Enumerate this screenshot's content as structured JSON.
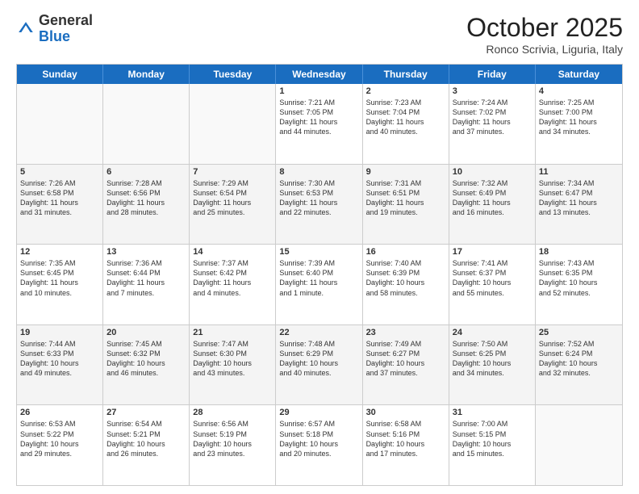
{
  "header": {
    "logo_general": "General",
    "logo_blue": "Blue",
    "month_title": "October 2025",
    "location": "Ronco Scrivia, Liguria, Italy"
  },
  "days_of_week": [
    "Sunday",
    "Monday",
    "Tuesday",
    "Wednesday",
    "Thursday",
    "Friday",
    "Saturday"
  ],
  "rows": [
    {
      "alt": false,
      "cells": [
        {
          "empty": true,
          "day": "",
          "text": ""
        },
        {
          "empty": true,
          "day": "",
          "text": ""
        },
        {
          "empty": true,
          "day": "",
          "text": ""
        },
        {
          "empty": false,
          "day": "1",
          "text": "Sunrise: 7:21 AM\nSunset: 7:05 PM\nDaylight: 11 hours\nand 44 minutes."
        },
        {
          "empty": false,
          "day": "2",
          "text": "Sunrise: 7:23 AM\nSunset: 7:04 PM\nDaylight: 11 hours\nand 40 minutes."
        },
        {
          "empty": false,
          "day": "3",
          "text": "Sunrise: 7:24 AM\nSunset: 7:02 PM\nDaylight: 11 hours\nand 37 minutes."
        },
        {
          "empty": false,
          "day": "4",
          "text": "Sunrise: 7:25 AM\nSunset: 7:00 PM\nDaylight: 11 hours\nand 34 minutes."
        }
      ]
    },
    {
      "alt": true,
      "cells": [
        {
          "empty": false,
          "day": "5",
          "text": "Sunrise: 7:26 AM\nSunset: 6:58 PM\nDaylight: 11 hours\nand 31 minutes."
        },
        {
          "empty": false,
          "day": "6",
          "text": "Sunrise: 7:28 AM\nSunset: 6:56 PM\nDaylight: 11 hours\nand 28 minutes."
        },
        {
          "empty": false,
          "day": "7",
          "text": "Sunrise: 7:29 AM\nSunset: 6:54 PM\nDaylight: 11 hours\nand 25 minutes."
        },
        {
          "empty": false,
          "day": "8",
          "text": "Sunrise: 7:30 AM\nSunset: 6:53 PM\nDaylight: 11 hours\nand 22 minutes."
        },
        {
          "empty": false,
          "day": "9",
          "text": "Sunrise: 7:31 AM\nSunset: 6:51 PM\nDaylight: 11 hours\nand 19 minutes."
        },
        {
          "empty": false,
          "day": "10",
          "text": "Sunrise: 7:32 AM\nSunset: 6:49 PM\nDaylight: 11 hours\nand 16 minutes."
        },
        {
          "empty": false,
          "day": "11",
          "text": "Sunrise: 7:34 AM\nSunset: 6:47 PM\nDaylight: 11 hours\nand 13 minutes."
        }
      ]
    },
    {
      "alt": false,
      "cells": [
        {
          "empty": false,
          "day": "12",
          "text": "Sunrise: 7:35 AM\nSunset: 6:45 PM\nDaylight: 11 hours\nand 10 minutes."
        },
        {
          "empty": false,
          "day": "13",
          "text": "Sunrise: 7:36 AM\nSunset: 6:44 PM\nDaylight: 11 hours\nand 7 minutes."
        },
        {
          "empty": false,
          "day": "14",
          "text": "Sunrise: 7:37 AM\nSunset: 6:42 PM\nDaylight: 11 hours\nand 4 minutes."
        },
        {
          "empty": false,
          "day": "15",
          "text": "Sunrise: 7:39 AM\nSunset: 6:40 PM\nDaylight: 11 hours\nand 1 minute."
        },
        {
          "empty": false,
          "day": "16",
          "text": "Sunrise: 7:40 AM\nSunset: 6:39 PM\nDaylight: 10 hours\nand 58 minutes."
        },
        {
          "empty": false,
          "day": "17",
          "text": "Sunrise: 7:41 AM\nSunset: 6:37 PM\nDaylight: 10 hours\nand 55 minutes."
        },
        {
          "empty": false,
          "day": "18",
          "text": "Sunrise: 7:43 AM\nSunset: 6:35 PM\nDaylight: 10 hours\nand 52 minutes."
        }
      ]
    },
    {
      "alt": true,
      "cells": [
        {
          "empty": false,
          "day": "19",
          "text": "Sunrise: 7:44 AM\nSunset: 6:33 PM\nDaylight: 10 hours\nand 49 minutes."
        },
        {
          "empty": false,
          "day": "20",
          "text": "Sunrise: 7:45 AM\nSunset: 6:32 PM\nDaylight: 10 hours\nand 46 minutes."
        },
        {
          "empty": false,
          "day": "21",
          "text": "Sunrise: 7:47 AM\nSunset: 6:30 PM\nDaylight: 10 hours\nand 43 minutes."
        },
        {
          "empty": false,
          "day": "22",
          "text": "Sunrise: 7:48 AM\nSunset: 6:29 PM\nDaylight: 10 hours\nand 40 minutes."
        },
        {
          "empty": false,
          "day": "23",
          "text": "Sunrise: 7:49 AM\nSunset: 6:27 PM\nDaylight: 10 hours\nand 37 minutes."
        },
        {
          "empty": false,
          "day": "24",
          "text": "Sunrise: 7:50 AM\nSunset: 6:25 PM\nDaylight: 10 hours\nand 34 minutes."
        },
        {
          "empty": false,
          "day": "25",
          "text": "Sunrise: 7:52 AM\nSunset: 6:24 PM\nDaylight: 10 hours\nand 32 minutes."
        }
      ]
    },
    {
      "alt": false,
      "cells": [
        {
          "empty": false,
          "day": "26",
          "text": "Sunrise: 6:53 AM\nSunset: 5:22 PM\nDaylight: 10 hours\nand 29 minutes."
        },
        {
          "empty": false,
          "day": "27",
          "text": "Sunrise: 6:54 AM\nSunset: 5:21 PM\nDaylight: 10 hours\nand 26 minutes."
        },
        {
          "empty": false,
          "day": "28",
          "text": "Sunrise: 6:56 AM\nSunset: 5:19 PM\nDaylight: 10 hours\nand 23 minutes."
        },
        {
          "empty": false,
          "day": "29",
          "text": "Sunrise: 6:57 AM\nSunset: 5:18 PM\nDaylight: 10 hours\nand 20 minutes."
        },
        {
          "empty": false,
          "day": "30",
          "text": "Sunrise: 6:58 AM\nSunset: 5:16 PM\nDaylight: 10 hours\nand 17 minutes."
        },
        {
          "empty": false,
          "day": "31",
          "text": "Sunrise: 7:00 AM\nSunset: 5:15 PM\nDaylight: 10 hours\nand 15 minutes."
        },
        {
          "empty": true,
          "day": "",
          "text": ""
        }
      ]
    }
  ]
}
